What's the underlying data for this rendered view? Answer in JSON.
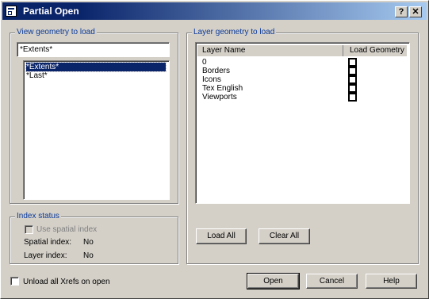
{
  "window": {
    "title": "Partial Open",
    "help_btn": "?",
    "close_btn": "✕"
  },
  "view_group": {
    "label": "View geometry to load",
    "selected_view": "*Extents*",
    "items": [
      "*Extents*",
      "*Last*"
    ]
  },
  "index_group": {
    "label": "Index status",
    "use_spatial_index": "Use spatial index",
    "spatial_index_label": "Spatial index:",
    "spatial_index_value": "No",
    "layer_index_label": "Layer index:",
    "layer_index_value": "No"
  },
  "layer_group": {
    "label": "Layer geometry to load",
    "col_name": "Layer Name",
    "col_load": "Load Geometry",
    "layers": [
      "0",
      "Borders",
      "Icons",
      "Tex English",
      "Viewports"
    ],
    "load_all": "Load All",
    "clear_all": "Clear All"
  },
  "unload_xrefs": "Unload all Xrefs on open",
  "buttons": {
    "open": "Open",
    "cancel": "Cancel",
    "help": "Help"
  }
}
